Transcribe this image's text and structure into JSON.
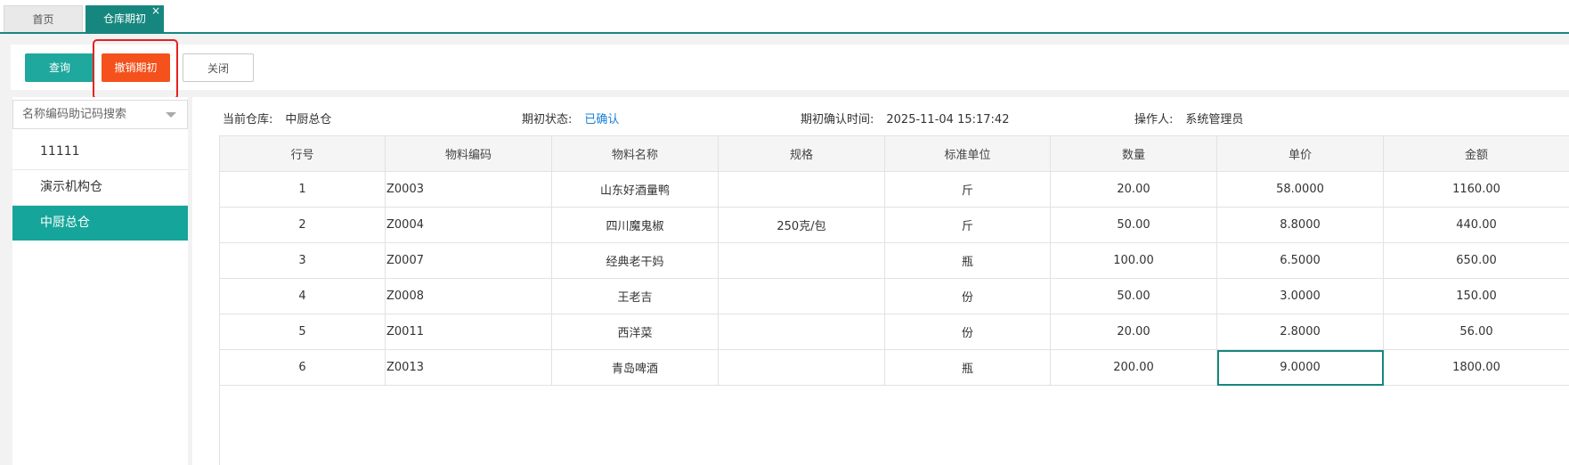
{
  "tabs": {
    "home": "首页",
    "active": "仓库期初",
    "close_icon": "×"
  },
  "toolbar": {
    "query": "查询",
    "cancel_opening": "撤销期初",
    "close": "关闭"
  },
  "colors": {
    "primary": "#16877e",
    "danger": "#f5511c",
    "highlight": "#e62121",
    "link": "#1a7fd6"
  },
  "left": {
    "search_placeholder": "名称编码助记码搜索",
    "warehouses": [
      "11111",
      "演示机构仓",
      "中厨总仓"
    ],
    "selected_index": 2
  },
  "info": {
    "warehouse_label": "当前仓库:",
    "warehouse_value": "中厨总仓",
    "status_label": "期初状态:",
    "status_value": "已确认",
    "confirm_time_label": "期初确认时间:",
    "confirm_time_value": "2025-11-04 15:17:42",
    "operator_label": "操作人:",
    "operator_value": "系统管理员"
  },
  "table": {
    "columns": [
      "行号",
      "物料编码",
      "物料名称",
      "规格",
      "标准单位",
      "数量",
      "单价",
      "金额"
    ],
    "rows": [
      [
        "1",
        "Z0003",
        "山东好酒量鸭",
        "",
        "斤",
        "20.00",
        "58.0000",
        "1160.00"
      ],
      [
        "2",
        "Z0004",
        "四川魔鬼椒",
        "250克/包",
        "斤",
        "50.00",
        "8.8000",
        "440.00"
      ],
      [
        "3",
        "Z0007",
        "经典老干妈",
        "",
        "瓶",
        "100.00",
        "6.5000",
        "650.00"
      ],
      [
        "4",
        "Z0008",
        "王老吉",
        "",
        "份",
        "50.00",
        "3.0000",
        "150.00"
      ],
      [
        "5",
        "Z0011",
        "西洋菜",
        "",
        "份",
        "20.00",
        "2.8000",
        "56.00"
      ],
      [
        "6",
        "Z0013",
        "青岛啤酒",
        "",
        "瓶",
        "200.00",
        "9.0000",
        "1800.00"
      ]
    ]
  }
}
